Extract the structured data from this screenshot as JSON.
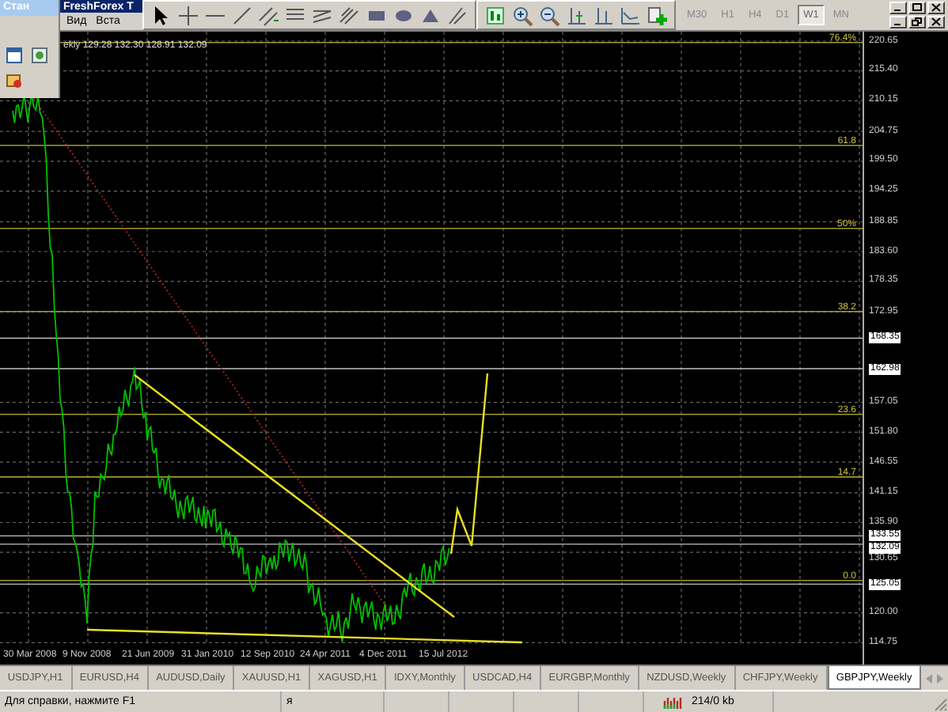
{
  "side_panel": {
    "title": "Стан"
  },
  "main_window": {
    "title": "FreshForex T",
    "menu": [
      "Вид",
      "Вста"
    ]
  },
  "timeframes": [
    {
      "label": "M30",
      "selected": false
    },
    {
      "label": "H1",
      "selected": false
    },
    {
      "label": "H4",
      "selected": false
    },
    {
      "label": "D1",
      "selected": false
    },
    {
      "label": "W1",
      "selected": true
    },
    {
      "label": "MN",
      "selected": false
    }
  ],
  "chart": {
    "header": "ekly  129.28 132.30 128.91 132.09",
    "fibonacci": [
      {
        "label": "76.4%"
      },
      {
        "label": "61.8"
      },
      {
        "label": "50%"
      },
      {
        "label": "38.2"
      },
      {
        "label": "23.6"
      },
      {
        "label": "14.7"
      },
      {
        "label": "0.0"
      }
    ],
    "price_axis": [
      {
        "label": "220.65",
        "kind": "tick"
      },
      {
        "label": "215.40",
        "kind": "tick"
      },
      {
        "label": "210.15",
        "kind": "tick"
      },
      {
        "label": "204.75",
        "kind": "tick"
      },
      {
        "label": "199.50",
        "kind": "tick"
      },
      {
        "label": "194.25",
        "kind": "tick"
      },
      {
        "label": "188.85",
        "kind": "tick"
      },
      {
        "label": "183.60",
        "kind": "tick"
      },
      {
        "label": "178.35",
        "kind": "tick"
      },
      {
        "label": "172.95",
        "kind": "tick"
      },
      {
        "label": "168.35",
        "kind": "marker"
      },
      {
        "label": "162.98",
        "kind": "marker"
      },
      {
        "label": "157.05",
        "kind": "tick"
      },
      {
        "label": "151.80",
        "kind": "tick"
      },
      {
        "label": "146.55",
        "kind": "tick"
      },
      {
        "label": "141.15",
        "kind": "tick"
      },
      {
        "label": "135.90",
        "kind": "tick"
      },
      {
        "label": "133.55",
        "kind": "marker"
      },
      {
        "label": "132.09",
        "kind": "marker"
      },
      {
        "label": "130.65",
        "kind": "tick"
      },
      {
        "label": "125.05",
        "kind": "marker"
      },
      {
        "label": "120.00",
        "kind": "tick"
      },
      {
        "label": "114.75",
        "kind": "tick"
      }
    ],
    "time_axis": [
      "30 Mar 2008",
      "9 Nov 2008",
      "21 Jun 2009",
      "31 Jan 2010",
      "12 Sep 2010",
      "24 Apr 2011",
      "4 Dec 2011",
      "15 Jul 2012"
    ]
  },
  "tabs": [
    {
      "label": "USDJPY,H1",
      "selected": false
    },
    {
      "label": "EURUSD,H4",
      "selected": false
    },
    {
      "label": "AUDUSD,Daily",
      "selected": false
    },
    {
      "label": "XAUUSD,H1",
      "selected": false
    },
    {
      "label": "XAGUSD,H1",
      "selected": false
    },
    {
      "label": "IDXY,Monthly",
      "selected": false
    },
    {
      "label": "USDCAD,H4",
      "selected": false
    },
    {
      "label": "EURGBP,Monthly",
      "selected": false
    },
    {
      "label": "NZDUSD,Weekly",
      "selected": false
    },
    {
      "label": "CHFJPY,Weekly",
      "selected": false
    },
    {
      "label": "GBPJPY,Weekly",
      "selected": true
    }
  ],
  "status_bar": {
    "help": "Для справки, нажмите F1",
    "profile": "я",
    "traffic": "214/0 kb"
  }
}
